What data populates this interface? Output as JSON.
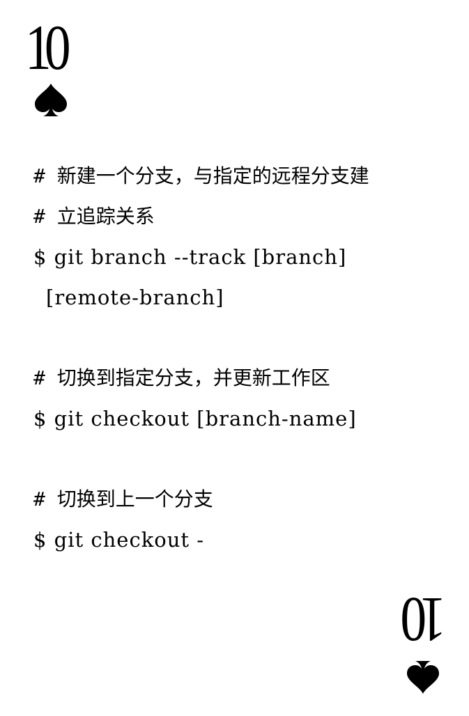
{
  "card": {
    "rank": "10",
    "suit_icon": "spade-icon"
  },
  "sections": [
    {
      "comment_lines": [
        "# 新建一个分支，与指定的远程分支建",
        "# 立追踪关系"
      ],
      "command_lines": [
        "$ git branch --track [branch]",
        "[remote-branch]"
      ]
    },
    {
      "comment_lines": [
        "# 切换到指定分支，并更新工作区"
      ],
      "command_lines": [
        "$ git checkout [branch-name]"
      ]
    },
    {
      "comment_lines": [
        "# 切换到上一个分支"
      ],
      "command_lines": [
        "$ git checkout -"
      ]
    }
  ]
}
